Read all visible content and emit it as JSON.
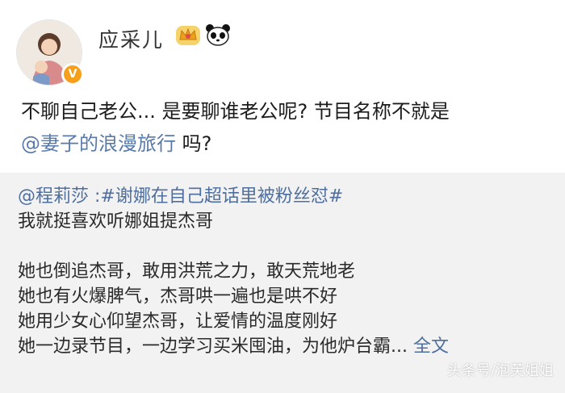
{
  "user": {
    "name": "应采儿",
    "verified_badge": "V",
    "badges": [
      "crown-icon",
      "panda-icon"
    ]
  },
  "post": {
    "text": "不聊自己老公... 是要聊谁老公呢? 节目名称不就是",
    "mention": "@妻子的浪漫旅行",
    "suffix": " 吗?"
  },
  "repost": {
    "author": "@程莉莎",
    "topic": ":#谢娜在自己超话里被粉丝怼#",
    "lines": [
      "我就挺喜欢听娜姐提杰哥",
      "",
      "她也倒追杰哥，敢用洪荒之力，敢天荒地老",
      "她也有火爆脾气，杰哥哄一遍也是哄不好",
      "她用少女心仰望杰哥，让爱情的温度刚好",
      "她一边录节目，一边学习买米囤油，为他炉台霸..."
    ],
    "more_label": "全文"
  },
  "watermark": "头条号/泡芙姐姐",
  "colors": {
    "link": "#4f6f9f",
    "repost_bg": "#f2f2f2",
    "verified": "#f59f1b"
  }
}
